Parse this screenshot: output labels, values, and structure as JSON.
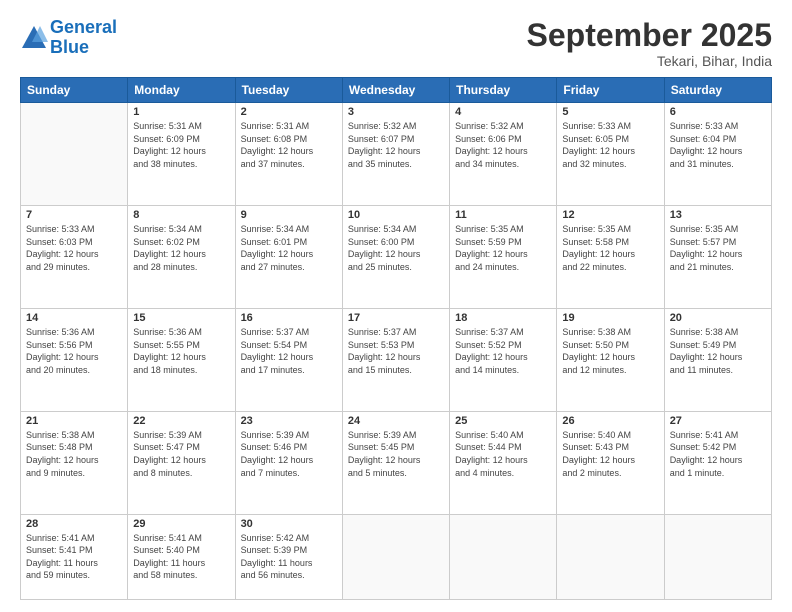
{
  "header": {
    "logo_line1": "General",
    "logo_line2": "Blue",
    "title": "September 2025",
    "subtitle": "Tekari, Bihar, India"
  },
  "weekdays": [
    "Sunday",
    "Monday",
    "Tuesday",
    "Wednesday",
    "Thursday",
    "Friday",
    "Saturday"
  ],
  "weeks": [
    [
      {
        "day": "",
        "info": ""
      },
      {
        "day": "1",
        "info": "Sunrise: 5:31 AM\nSunset: 6:09 PM\nDaylight: 12 hours\nand 38 minutes."
      },
      {
        "day": "2",
        "info": "Sunrise: 5:31 AM\nSunset: 6:08 PM\nDaylight: 12 hours\nand 37 minutes."
      },
      {
        "day": "3",
        "info": "Sunrise: 5:32 AM\nSunset: 6:07 PM\nDaylight: 12 hours\nand 35 minutes."
      },
      {
        "day": "4",
        "info": "Sunrise: 5:32 AM\nSunset: 6:06 PM\nDaylight: 12 hours\nand 34 minutes."
      },
      {
        "day": "5",
        "info": "Sunrise: 5:33 AM\nSunset: 6:05 PM\nDaylight: 12 hours\nand 32 minutes."
      },
      {
        "day": "6",
        "info": "Sunrise: 5:33 AM\nSunset: 6:04 PM\nDaylight: 12 hours\nand 31 minutes."
      }
    ],
    [
      {
        "day": "7",
        "info": "Sunrise: 5:33 AM\nSunset: 6:03 PM\nDaylight: 12 hours\nand 29 minutes."
      },
      {
        "day": "8",
        "info": "Sunrise: 5:34 AM\nSunset: 6:02 PM\nDaylight: 12 hours\nand 28 minutes."
      },
      {
        "day": "9",
        "info": "Sunrise: 5:34 AM\nSunset: 6:01 PM\nDaylight: 12 hours\nand 27 minutes."
      },
      {
        "day": "10",
        "info": "Sunrise: 5:34 AM\nSunset: 6:00 PM\nDaylight: 12 hours\nand 25 minutes."
      },
      {
        "day": "11",
        "info": "Sunrise: 5:35 AM\nSunset: 5:59 PM\nDaylight: 12 hours\nand 24 minutes."
      },
      {
        "day": "12",
        "info": "Sunrise: 5:35 AM\nSunset: 5:58 PM\nDaylight: 12 hours\nand 22 minutes."
      },
      {
        "day": "13",
        "info": "Sunrise: 5:35 AM\nSunset: 5:57 PM\nDaylight: 12 hours\nand 21 minutes."
      }
    ],
    [
      {
        "day": "14",
        "info": "Sunrise: 5:36 AM\nSunset: 5:56 PM\nDaylight: 12 hours\nand 20 minutes."
      },
      {
        "day": "15",
        "info": "Sunrise: 5:36 AM\nSunset: 5:55 PM\nDaylight: 12 hours\nand 18 minutes."
      },
      {
        "day": "16",
        "info": "Sunrise: 5:37 AM\nSunset: 5:54 PM\nDaylight: 12 hours\nand 17 minutes."
      },
      {
        "day": "17",
        "info": "Sunrise: 5:37 AM\nSunset: 5:53 PM\nDaylight: 12 hours\nand 15 minutes."
      },
      {
        "day": "18",
        "info": "Sunrise: 5:37 AM\nSunset: 5:52 PM\nDaylight: 12 hours\nand 14 minutes."
      },
      {
        "day": "19",
        "info": "Sunrise: 5:38 AM\nSunset: 5:50 PM\nDaylight: 12 hours\nand 12 minutes."
      },
      {
        "day": "20",
        "info": "Sunrise: 5:38 AM\nSunset: 5:49 PM\nDaylight: 12 hours\nand 11 minutes."
      }
    ],
    [
      {
        "day": "21",
        "info": "Sunrise: 5:38 AM\nSunset: 5:48 PM\nDaylight: 12 hours\nand 9 minutes."
      },
      {
        "day": "22",
        "info": "Sunrise: 5:39 AM\nSunset: 5:47 PM\nDaylight: 12 hours\nand 8 minutes."
      },
      {
        "day": "23",
        "info": "Sunrise: 5:39 AM\nSunset: 5:46 PM\nDaylight: 12 hours\nand 7 minutes."
      },
      {
        "day": "24",
        "info": "Sunrise: 5:39 AM\nSunset: 5:45 PM\nDaylight: 12 hours\nand 5 minutes."
      },
      {
        "day": "25",
        "info": "Sunrise: 5:40 AM\nSunset: 5:44 PM\nDaylight: 12 hours\nand 4 minutes."
      },
      {
        "day": "26",
        "info": "Sunrise: 5:40 AM\nSunset: 5:43 PM\nDaylight: 12 hours\nand 2 minutes."
      },
      {
        "day": "27",
        "info": "Sunrise: 5:41 AM\nSunset: 5:42 PM\nDaylight: 12 hours\nand 1 minute."
      }
    ],
    [
      {
        "day": "28",
        "info": "Sunrise: 5:41 AM\nSunset: 5:41 PM\nDaylight: 11 hours\nand 59 minutes."
      },
      {
        "day": "29",
        "info": "Sunrise: 5:41 AM\nSunset: 5:40 PM\nDaylight: 11 hours\nand 58 minutes."
      },
      {
        "day": "30",
        "info": "Sunrise: 5:42 AM\nSunset: 5:39 PM\nDaylight: 11 hours\nand 56 minutes."
      },
      {
        "day": "",
        "info": ""
      },
      {
        "day": "",
        "info": ""
      },
      {
        "day": "",
        "info": ""
      },
      {
        "day": "",
        "info": ""
      }
    ]
  ]
}
